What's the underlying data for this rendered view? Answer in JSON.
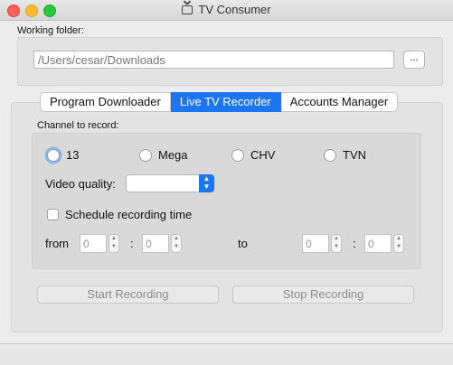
{
  "window": {
    "title": "TV Consumer",
    "title_icon": "tv-icon"
  },
  "working_folder": {
    "label": "Working folder:",
    "path": "/Users/cesar/Downloads",
    "browse_label": "..."
  },
  "tabs": [
    {
      "label": "Program Downloader",
      "selected": false
    },
    {
      "label": "Live TV Recorder",
      "selected": true
    },
    {
      "label": "Accounts Manager",
      "selected": false
    }
  ],
  "recorder": {
    "channel_label": "Channel to record:",
    "channels": [
      {
        "label": "13",
        "selected": false
      },
      {
        "label": "Mega",
        "selected": false
      },
      {
        "label": "CHV",
        "selected": false
      },
      {
        "label": "TVN",
        "selected": false
      }
    ],
    "video_quality_label": "Video quality:",
    "video_quality_value": "",
    "schedule_label": "Schedule recording time",
    "schedule_checked": false,
    "from_label": "from",
    "to_label": "to",
    "from_hours": "0",
    "from_minutes": "0",
    "to_hours": "0",
    "to_minutes": "0",
    "time_separator": ":",
    "start_button": "Start Recording",
    "stop_button": "Stop Recording"
  },
  "colors": {
    "accent": "#1c76f2",
    "window_bg": "#ececec",
    "group_bg": "#e3e3e3"
  }
}
